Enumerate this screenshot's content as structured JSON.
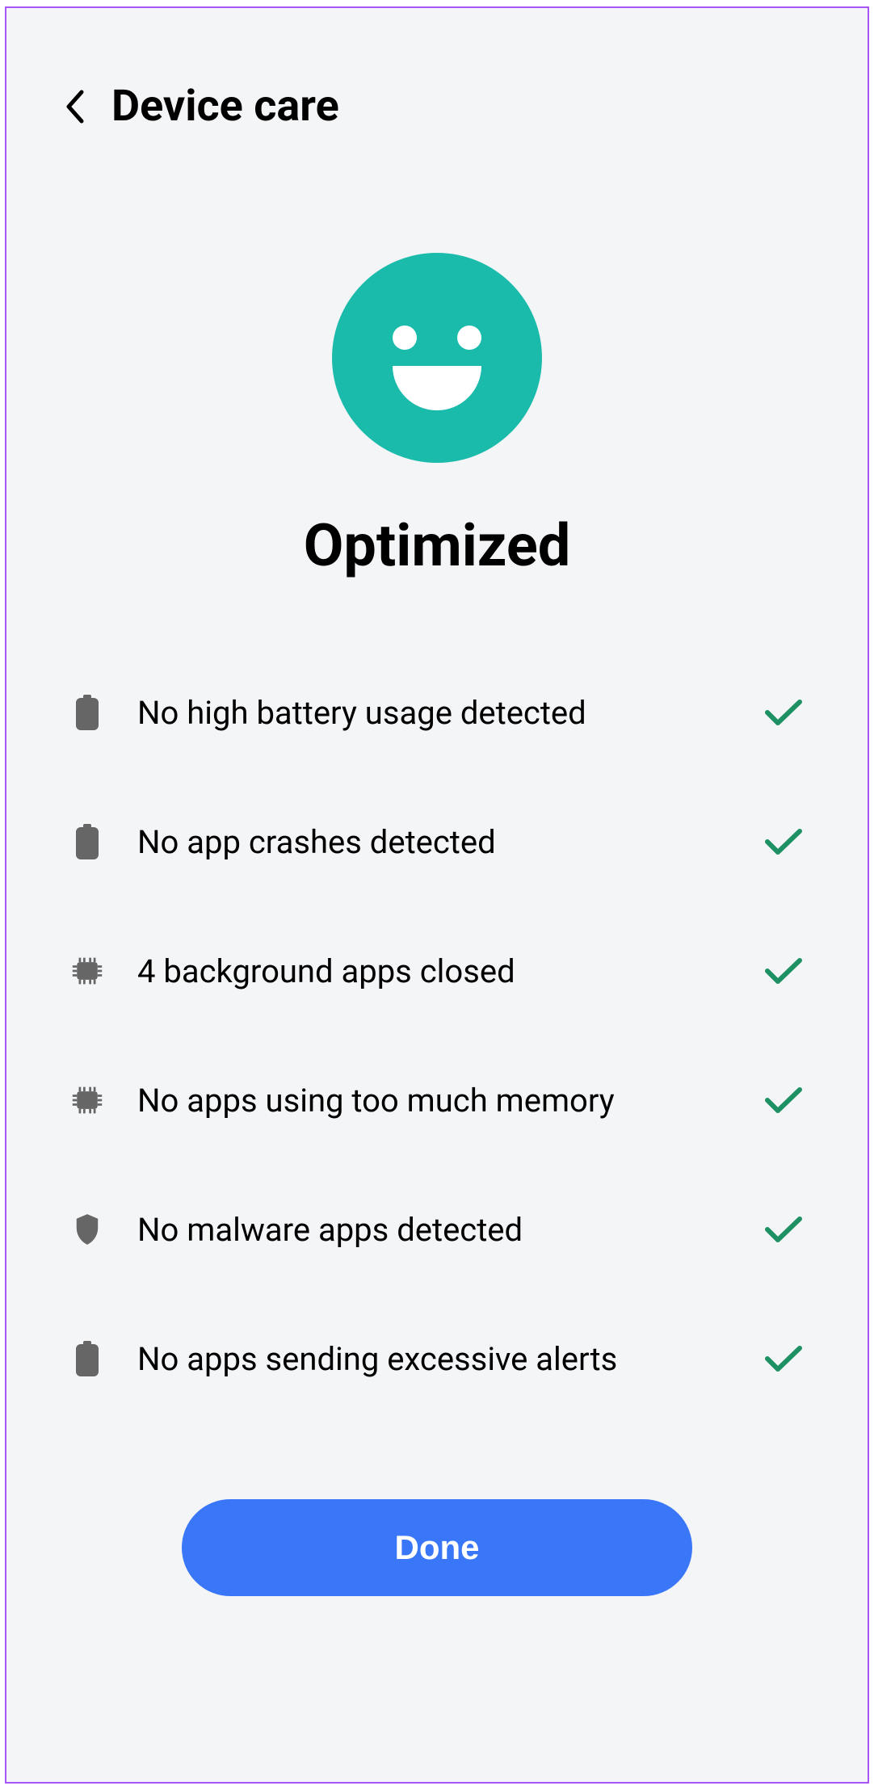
{
  "header": {
    "title": "Device care"
  },
  "status": {
    "title": "Optimized"
  },
  "items": [
    {
      "icon": "battery",
      "label": "No high battery usage detected"
    },
    {
      "icon": "battery",
      "label": "No app crashes detected"
    },
    {
      "icon": "chip",
      "label": "4 background apps closed"
    },
    {
      "icon": "chip",
      "label": "No apps using too much memory"
    },
    {
      "icon": "shield",
      "label": "No malware apps detected"
    },
    {
      "icon": "battery",
      "label": "No apps sending excessive alerts"
    }
  ],
  "footer": {
    "done_label": "Done"
  },
  "colors": {
    "accent": "#1bbbac",
    "primary_button": "#3a77f8",
    "check": "#1d9163",
    "icon_gray": "#666666"
  }
}
